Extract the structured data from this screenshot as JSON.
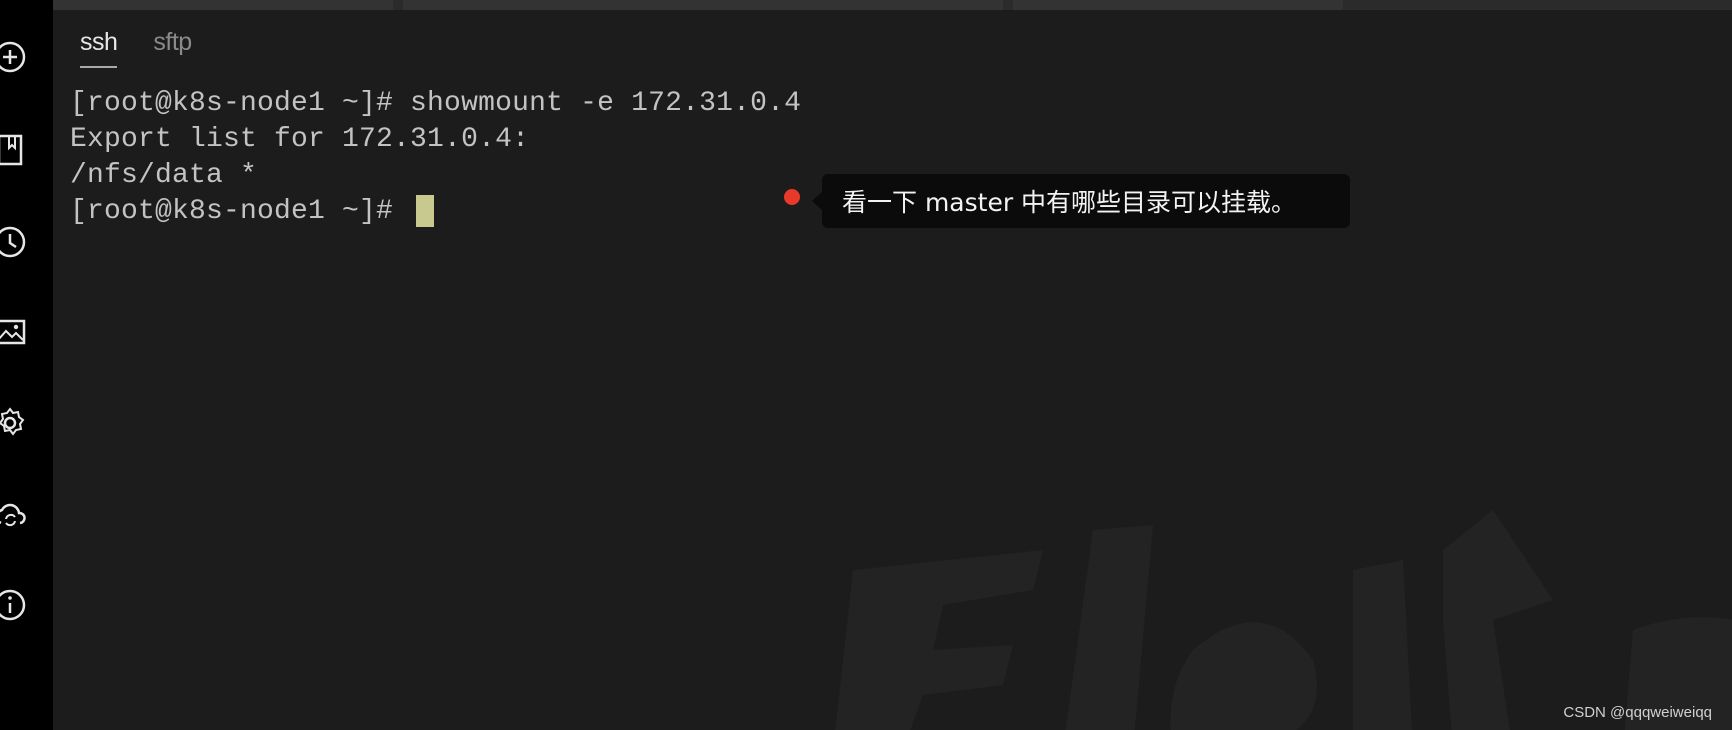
{
  "sidebar": {
    "icons": [
      "add-icon",
      "notebook-icon",
      "history-icon",
      "image-icon",
      "settings-icon",
      "cloud-sync-icon",
      "info-icon"
    ]
  },
  "tabs": [
    {
      "label": "ssh",
      "active": true
    },
    {
      "label": "sftp",
      "active": false
    }
  ],
  "terminal": {
    "lines": [
      "[root@k8s-node1 ~]# showmount -e 172.31.0.4",
      "Export list for 172.31.0.4:",
      "/nfs/data *",
      "[root@k8s-node1 ~]# "
    ],
    "cursor_color": "#c7c98e"
  },
  "annotation": {
    "text": "看一下 master 中有哪些目录可以挂载。",
    "dot_color": "#e8392b"
  },
  "watermark": "CSDN @qqqweiweiqq",
  "colors": {
    "background": "#1c1c1c",
    "sidebar": "#000000",
    "text": "#c3c3c3"
  }
}
